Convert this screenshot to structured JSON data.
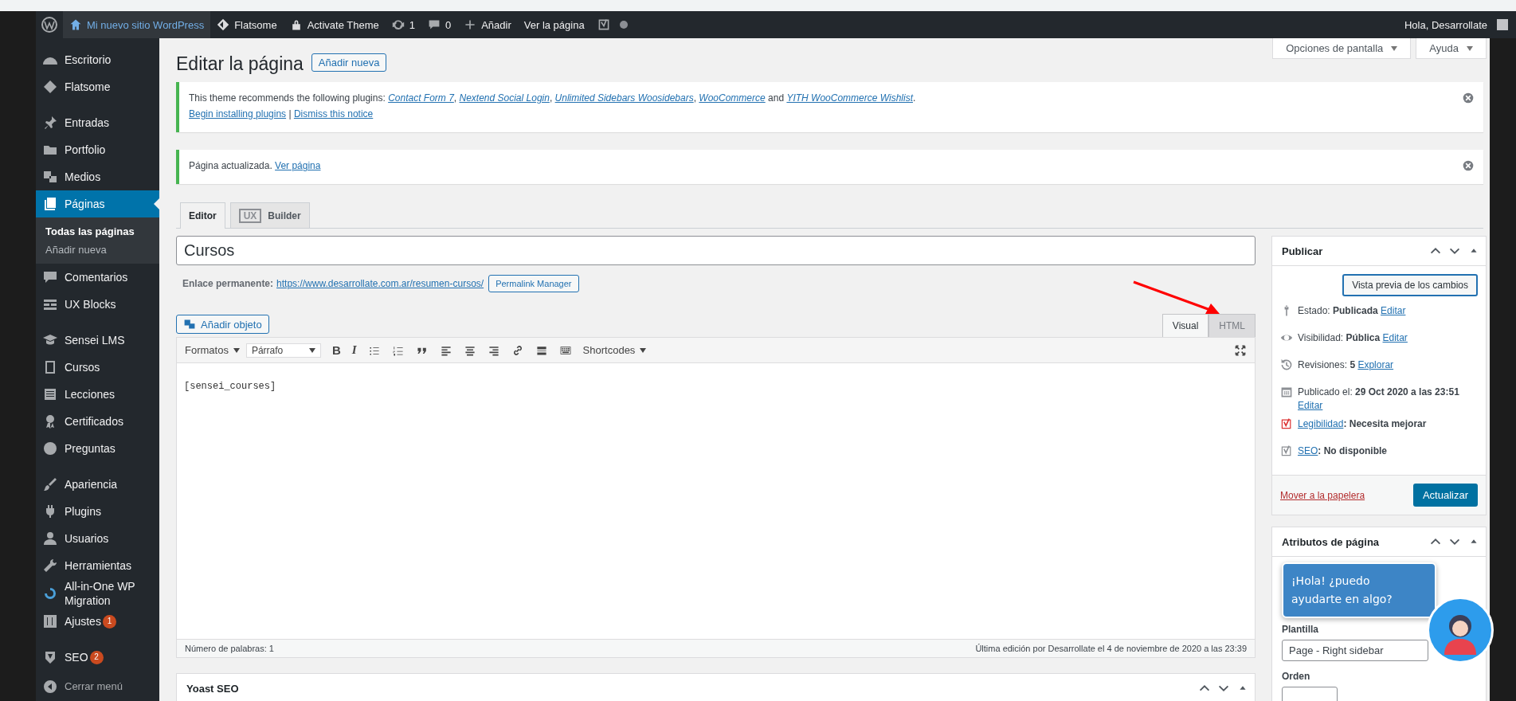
{
  "admin_bar": {
    "items": [
      {
        "kind": "wordpress"
      },
      {
        "kind": "site",
        "label": "Mi nuevo sitio WordPress"
      },
      {
        "kind": "theme",
        "label": "Flatsome"
      },
      {
        "kind": "activate",
        "label": "Activate Theme"
      },
      {
        "kind": "updates",
        "label": "1"
      },
      {
        "kind": "comments",
        "label": "0"
      },
      {
        "kind": "new",
        "label": "Añadir"
      },
      {
        "kind": "view",
        "label": "Ver la página"
      },
      {
        "kind": "seo"
      },
      {
        "kind": "status"
      }
    ],
    "greeting": "Hola, Desarrollate"
  },
  "sidebar": {
    "groups": [
      [
        {
          "label": "Escritorio",
          "selected": false
        },
        {
          "label": "Flatsome",
          "selected": false
        }
      ],
      [
        {
          "label": "Entradas",
          "selected": false
        },
        {
          "label": "Portfolio",
          "selected": false
        },
        {
          "label": "Medios",
          "selected": false
        },
        {
          "label": "Páginas",
          "selected": true,
          "children": [
            {
              "label": "Todas las páginas",
              "selected": true
            },
            {
              "label": "Añadir nueva",
              "selected": false
            }
          ]
        },
        {
          "label": "Comentarios",
          "selected": false
        },
        {
          "label": "UX Blocks",
          "selected": false
        }
      ],
      [
        {
          "label": "Sensei LMS",
          "selected": false
        },
        {
          "label": "Cursos",
          "selected": false
        },
        {
          "label": "Lecciones",
          "selected": false
        },
        {
          "label": "Certificados",
          "selected": false
        },
        {
          "label": "Preguntas",
          "selected": false
        }
      ],
      [
        {
          "label": "Apariencia",
          "selected": false
        },
        {
          "label": "Plugins",
          "selected": false
        },
        {
          "label": "Usuarios",
          "selected": false
        },
        {
          "label": "Herramientas",
          "selected": false
        },
        {
          "label": "All-in-One WP Migration",
          "selected": false
        },
        {
          "label": "Ajustes",
          "selected": false,
          "badge": "1"
        }
      ],
      [
        {
          "label": "SEO",
          "selected": false,
          "badge": "2"
        }
      ]
    ],
    "collapse": "Cerrar menú"
  },
  "screen_buttons": [
    "Opciones de pantalla",
    "Ayuda"
  ],
  "page_title": "Editar la página",
  "add_new": "Añadir nueva",
  "notices": [
    {
      "lines": [
        [
          {
            "kind": "text",
            "text": "This theme recommends the following plugins: "
          },
          {
            "kind": "link",
            "text": "Contact Form 7"
          },
          {
            "kind": "text",
            "text": ", "
          },
          {
            "kind": "link",
            "text": "Nextend Social Login"
          },
          {
            "kind": "text",
            "text": ", "
          },
          {
            "kind": "link",
            "text": "Unlimited Sidebars Woosidebars"
          },
          {
            "kind": "text",
            "text": ", "
          },
          {
            "kind": "link",
            "text": "WooCommerce"
          },
          {
            "kind": "text",
            "text": " and "
          },
          {
            "kind": "link",
            "text": "YITH WooCommerce Wishlist"
          },
          {
            "kind": "text",
            "text": "."
          }
        ],
        [
          {
            "kind": "action",
            "text": "Begin installing plugins"
          },
          {
            "kind": "text",
            "text": " | "
          },
          {
            "kind": "action",
            "text": "Dismiss this notice"
          }
        ]
      ]
    },
    {
      "lines": [
        [
          {
            "kind": "text",
            "text": "Página actualizada. "
          },
          {
            "kind": "action",
            "text": "Ver página"
          }
        ]
      ]
    }
  ],
  "editor_tabs": [
    {
      "label": "Editor",
      "selected": true
    },
    {
      "label": "Builder",
      "badge": "UX",
      "selected": false
    }
  ],
  "title": "Cursos",
  "permalink": {
    "label": "Enlace permanente:",
    "url": "https://www.desarrollate.com.ar/resumen-cursos/",
    "button": "Permalink Manager"
  },
  "add_media": "Añadir objeto",
  "mode_tabs": [
    {
      "label": "Visual",
      "selected": true
    },
    {
      "label": "HTML",
      "selected": false
    }
  ],
  "toolbar": {
    "formats": "Formatos",
    "block": "Párrafo",
    "bold": "B",
    "italic": "I",
    "shortcodes": "Shortcodes"
  },
  "content": "[sensei_courses]",
  "status": {
    "word_count": "Número de palabras: 1",
    "last_edit": "Última edición por Desarrollate el 4 de noviembre de 2020 a las 23:39"
  },
  "yoast_box": {
    "title": "Yoast SEO"
  },
  "publish": {
    "title": "Publicar",
    "preview": "Vista previa de los cambios",
    "rows": [
      {
        "kind": "meta",
        "label": "Estado:",
        "value": "Publicada",
        "link": "Editar"
      },
      {
        "kind": "meta",
        "label": "Visibilidad:",
        "value": "Pública",
        "link": "Editar"
      },
      {
        "kind": "meta",
        "label": "Revisiones:",
        "value": "5",
        "link": "Explorar"
      },
      {
        "kind": "meta",
        "label": "Publicado el:",
        "value": "29 Oct 2020 a las 23:51",
        "link": "Editar"
      },
      {
        "kind": "score",
        "link": "Legibilidad",
        "value": ": Necesita mejorar",
        "color": "#dc3232"
      },
      {
        "kind": "score",
        "link": "SEO",
        "value": ": No disponible",
        "color": "#8c8f94"
      }
    ],
    "trash": "Mover a la papelera",
    "update": "Actualizar"
  },
  "attributes": {
    "title": "Atributos de página",
    "template_label": "Plantilla",
    "template": "Page - Right sidebar",
    "order_label": "Orden"
  },
  "chat": {
    "message": "¡Hola! ¿puedo ayudarte en algo?"
  }
}
